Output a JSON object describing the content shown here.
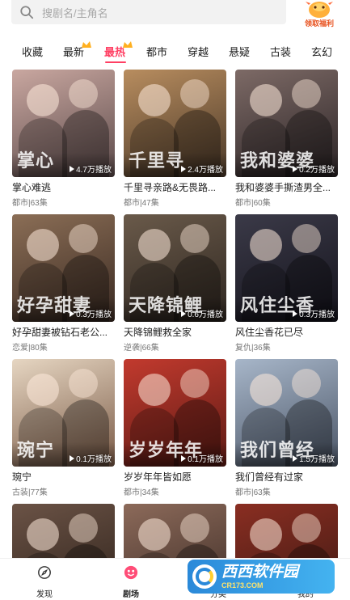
{
  "search": {
    "placeholder": "搜剧名/主角名"
  },
  "welfare": {
    "label": "领取福利"
  },
  "tabs": [
    {
      "label": "收藏",
      "active": false
    },
    {
      "label": "最新",
      "active": false,
      "badge": true
    },
    {
      "label": "最热",
      "active": true,
      "badge": true
    },
    {
      "label": "都市",
      "active": false
    },
    {
      "label": "穿越",
      "active": false
    },
    {
      "label": "悬疑",
      "active": false
    },
    {
      "label": "古装",
      "active": false
    },
    {
      "label": "玄幻",
      "active": false
    }
  ],
  "dramas": [
    {
      "title": "掌心难逃",
      "meta": "都市|63集",
      "plays": "4.7万播放",
      "cover_text": "掌心",
      "colors": [
        "#c9a7a0",
        "#5b4a4a"
      ]
    },
    {
      "title": "千里寻亲路&无畏路...",
      "meta": "都市|47集",
      "plays": "2.4万播放",
      "cover_text": "千里寻",
      "colors": [
        "#b88d5f",
        "#4a3828"
      ]
    },
    {
      "title": "我和婆婆手撕渣男全...",
      "meta": "都市|60集",
      "plays": "0.2万播放",
      "cover_text": "我和婆婆",
      "colors": [
        "#7d6a66",
        "#2b2426"
      ]
    },
    {
      "title": "好孕甜妻被钻石老公...",
      "meta": "恋爱|80集",
      "plays": "0.3万播放",
      "cover_text": "好孕甜妻",
      "colors": [
        "#8b6e56",
        "#3a2a22"
      ]
    },
    {
      "title": "天降锦鲤救全家",
      "meta": "逆袭|66集",
      "plays": "0.6万播放",
      "cover_text": "天降锦鲤",
      "colors": [
        "#6a5a4a",
        "#2e2620"
      ]
    },
    {
      "title": "风住尘香花已尽",
      "meta": "复仇|36集",
      "plays": "0.3万播放",
      "cover_text": "风住尘香",
      "colors": [
        "#3b3a48",
        "#14131c"
      ]
    },
    {
      "title": "琬宁",
      "meta": "古装|77集",
      "plays": "0.1万播放",
      "cover_text": "琬宁",
      "colors": [
        "#e6d6c2",
        "#7a5a46"
      ]
    },
    {
      "title": "岁岁年年皆如愿",
      "meta": "都市|34集",
      "plays": "0.1万播放",
      "cover_text": "岁岁年年",
      "colors": [
        "#c23a2e",
        "#5c1a14"
      ]
    },
    {
      "title": "我们曾经有过家",
      "meta": "都市|63集",
      "plays": "1.5万播放",
      "cover_text": "我们曾经",
      "colors": [
        "#a7b6c9",
        "#4b5566"
      ]
    },
    {
      "title": "",
      "meta": "",
      "plays": "",
      "cover_text": "",
      "colors": [
        "#6b5346",
        "#2c2019"
      ]
    },
    {
      "title": "",
      "meta": "",
      "plays": "",
      "cover_text": "",
      "colors": [
        "#8c6a5a",
        "#3a2a24"
      ]
    },
    {
      "title": "",
      "meta": "",
      "plays": "",
      "cover_text": "",
      "colors": [
        "#8a2e22",
        "#3a1812"
      ]
    }
  ],
  "nav": [
    {
      "label": "发现",
      "icon": "compass-icon",
      "active": false
    },
    {
      "label": "剧场",
      "icon": "theater-icon",
      "active": true
    },
    {
      "label": "分类",
      "icon": "category-icon",
      "active": false
    },
    {
      "label": "我的",
      "icon": "profile-icon",
      "active": false
    }
  ],
  "watermark": {
    "text": "西西软件园",
    "sub": "CR173.COM"
  }
}
